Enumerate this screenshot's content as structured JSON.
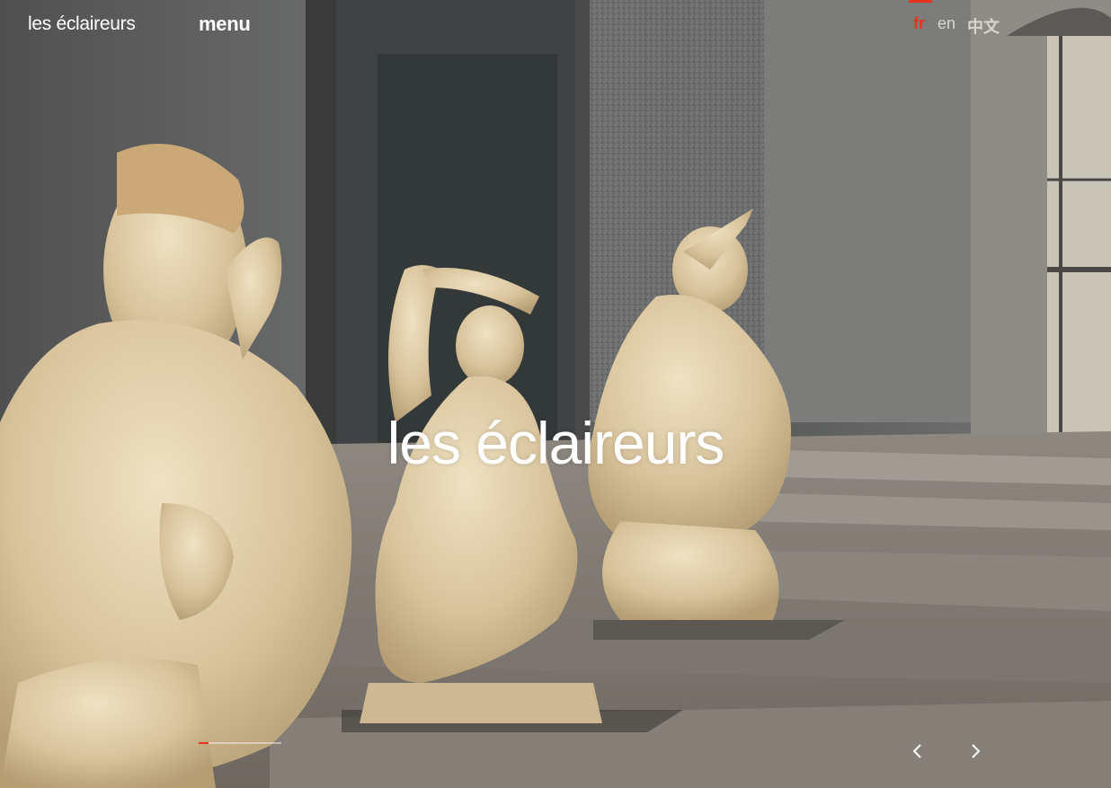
{
  "header": {
    "logo": "les éclaireurs",
    "menu_label": "menu",
    "languages": [
      {
        "code": "fr",
        "label": "fr",
        "active": true
      },
      {
        "code": "en",
        "label": "en",
        "active": false
      },
      {
        "code": "zh",
        "label": "中文",
        "active": false
      }
    ]
  },
  "hero": {
    "title": "les éclaireurs",
    "slider_progress": 0.12,
    "prev_icon": "chevron-left-icon",
    "next_icon": "chevron-right-icon"
  },
  "colors": {
    "accent": "#e8321d",
    "text": "#ffffff",
    "lang_inactive": "#d9d5cf"
  }
}
